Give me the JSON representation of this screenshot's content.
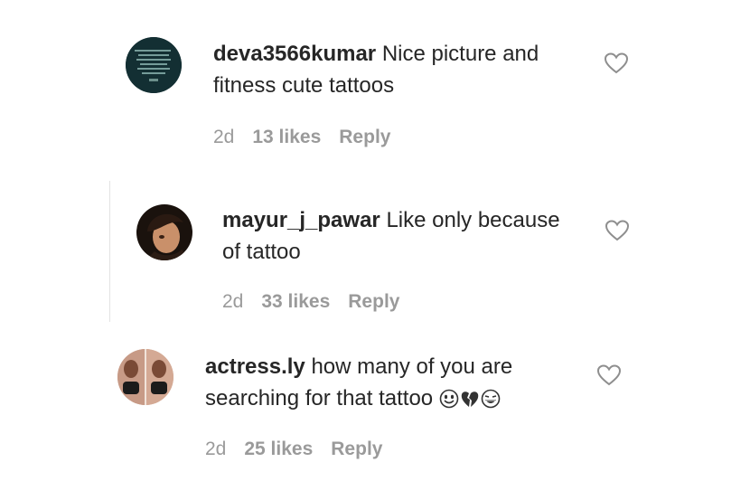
{
  "comments": [
    {
      "username": "deva3566kumar",
      "text": "Nice picture and fitness cute tattoos",
      "line2": "fitness cute tattoos",
      "line1_text": "Nice picture and",
      "time": "2d",
      "likes": "13 likes",
      "reply": "Reply",
      "avatar": "avatar-dark-quote-image",
      "like_icon": "heart-outline-icon"
    },
    {
      "username": "mayur_j_pawar",
      "line1_text": "Like only because",
      "line2": "of tattoo",
      "time": "2d",
      "likes": "33 likes",
      "reply": "Reply",
      "avatar": "avatar-portrait-photo",
      "like_icon": "heart-outline-icon"
    },
    {
      "username": "actress.ly",
      "line1_text": "how many of you are",
      "line2": "searching for that tattoo",
      "emojis": [
        "smile-face-emoji",
        "broken-heart-emoji",
        "laughing-face-emoji"
      ],
      "time": "2d",
      "likes": "25 likes",
      "reply": "Reply",
      "avatar": "avatar-twin-photo",
      "like_icon": "heart-outline-icon"
    }
  ],
  "colors": {
    "text": "#262626",
    "meta": "#9a9a9a",
    "heart_stroke": "#8e8e8e",
    "thread_line": "#e3e3e3"
  }
}
